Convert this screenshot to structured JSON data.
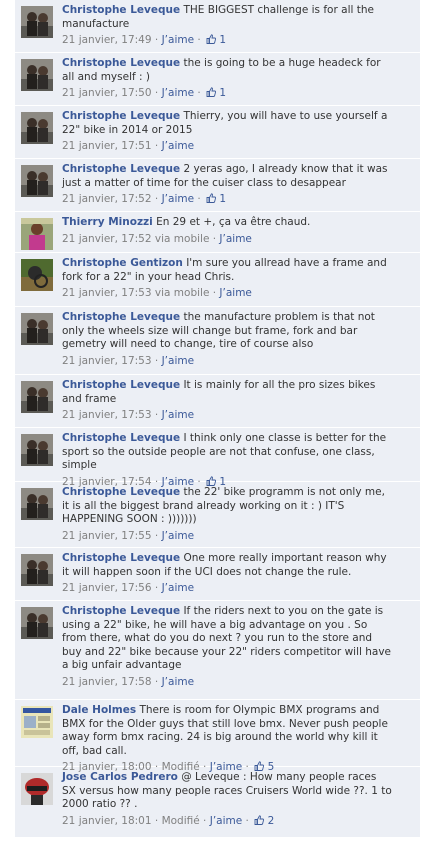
{
  "comments": [
    {
      "author": "Christophe Leveque",
      "text": "THE BIGGEST challenge is for all the manufacture",
      "time": "21 janvier, 17:49",
      "like_label": "J’aime",
      "likes": "1",
      "avatar": "christophe-leveque-avatar"
    },
    {
      "author": "Christophe Leveque",
      "text": "the is going to be a huge headeck for all and myself : )",
      "time": "21 janvier, 17:50",
      "like_label": "J’aime",
      "likes": "1",
      "avatar": "christophe-leveque-avatar"
    },
    {
      "author": "Christophe Leveque",
      "text": "Thierry, you will have to use yourself a 22\" bike in 2014 or 2015",
      "time": "21 janvier, 17:51",
      "like_label": "J’aime",
      "avatar": "christophe-leveque-avatar"
    },
    {
      "author": "Christophe Leveque",
      "text": "2 yeras ago, I already know that it was just a matter of time for the cuiser class to desappear",
      "time": "21 janvier, 17:52",
      "like_label": "J’aime",
      "likes": "1",
      "avatar": "christophe-leveque-avatar"
    },
    {
      "author": "Thierry Minozzi",
      "text": "En 29 et +, ça va être chaud.",
      "time": "21 janvier, 17:52 via mobile",
      "like_label": "J’aime",
      "avatar": "thierry-minozzi-avatar"
    },
    {
      "author": "Christophe Gentizon",
      "text": "I'm sure you allread have a frame and fork for a 22\" in your head Chris.",
      "time": "21 janvier, 17:53 via mobile",
      "like_label": "J’aime",
      "avatar": "christophe-gentizon-avatar"
    },
    {
      "author": "Christophe Leveque",
      "text": "the manufacture problem is that not only the wheels size will change but frame, fork and bar gemetry will need to change, tire of course also",
      "time": "21 janvier, 17:53",
      "like_label": "J’aime",
      "avatar": "christophe-leveque-avatar"
    },
    {
      "author": "Christophe Leveque",
      "text": "It is mainly for all the pro sizes bikes and frame",
      "time": "21 janvier, 17:53",
      "like_label": "J’aime",
      "avatar": "christophe-leveque-avatar"
    },
    {
      "author": "Christophe Leveque",
      "text": "I think only one classe is better for the sport so the outside people are not that confuse, one class, simple",
      "time": "21 janvier, 17:54",
      "like_label": "J’aime",
      "likes": "1",
      "avatar": "christophe-leveque-avatar"
    },
    {
      "author": "Christophe Leveque",
      "text": "the 22' bike programm is not only me, it is all the biggest brand already working on it : ) IT'S HAPPENING SOON : )))))))",
      "time": "21 janvier, 17:55",
      "like_label": "J’aime",
      "avatar": "christophe-leveque-avatar"
    },
    {
      "author": "Christophe Leveque",
      "text": "One more really important reason why it will happen soon if the UCI does not change the rule.",
      "time": "21 janvier, 17:56",
      "like_label": "J’aime",
      "avatar": "christophe-leveque-avatar"
    },
    {
      "author": "Christophe Leveque",
      "text": "If the riders next to you on the gate is using a 22\" bike, he will have a big advantage on you . So from there, what do you do next ? you run to the store and buy and 22\" bike because your 22\" riders competitor will have a big unfair advantage",
      "time": "21 janvier, 17:58",
      "like_label": "J’aime",
      "avatar": "christophe-leveque-avatar"
    },
    {
      "author": "Dale Holmes",
      "text": "There is room for Olympic BMX programs and BMX for the Older guys that still love bmx. Never push people away form bmx racing. 24 is big around the world why kill it off, bad call.",
      "time": "21 janvier, 18:00",
      "edited": "Modifié",
      "like_label": "J’aime",
      "likes": "5",
      "avatar": "dale-holmes-avatar"
    },
    {
      "author": "Jose Carlos Pedrero",
      "text": "@ Leveque : How many people races SX versus how many people races Cruisers World wide ??. 1 to 2000 ratio ?? .",
      "time": "21 janvier, 18:01",
      "edited": "Modifié",
      "like_label": "J’aime",
      "likes": "2",
      "avatar": "jose-carlos-pedrero-avatar"
    }
  ],
  "colors": {
    "link": "#3b5998",
    "meta": "#808080",
    "background": "#eceff5",
    "divider": "#ffffff"
  }
}
